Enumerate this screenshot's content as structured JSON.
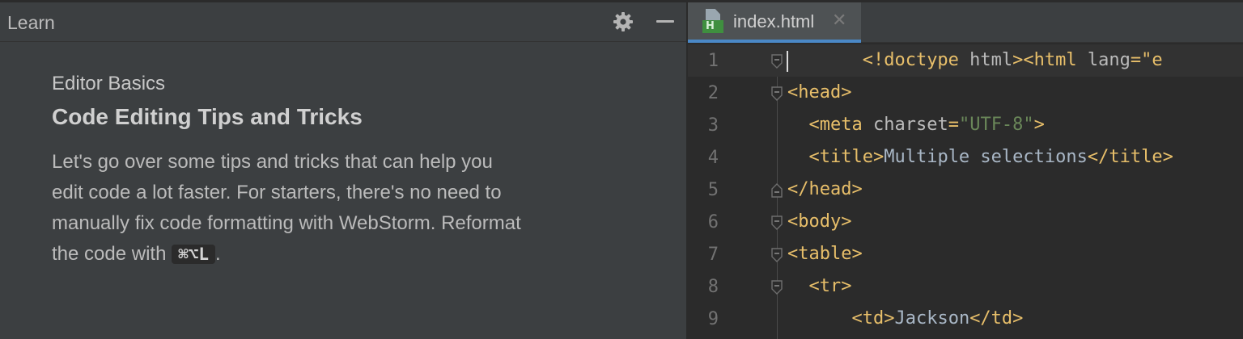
{
  "learn": {
    "title": "Learn",
    "section": "Editor Basics",
    "lesson_title": "Code Editing Tips and Tricks",
    "paragraph_lines": [
      "Let's go over some tips and tricks that can help you",
      "edit code a lot faster. For starters, there's no need to",
      "manually fix code formatting with WebStorm. Reformat",
      "the code with "
    ],
    "shortcut": "⌘⌥L",
    "paragraph_end": "."
  },
  "editor": {
    "tab": {
      "label": "index.html",
      "icon_badge": "H",
      "close": "✕"
    },
    "line_numbers": [
      "1",
      "2",
      "3",
      "4",
      "5",
      "6",
      "7",
      "8",
      "9"
    ],
    "lines": [
      {
        "indent": "       ",
        "parts": [
          [
            "tag",
            "<!doctype "
          ],
          [
            "attr",
            "html"
          ],
          [
            "tag",
            "><html "
          ],
          [
            "attr",
            "lang"
          ],
          [
            "tag",
            "=\"e"
          ]
        ]
      },
      {
        "indent": "",
        "parts": [
          [
            "tag",
            "<head>"
          ]
        ]
      },
      {
        "indent": "  ",
        "parts": [
          [
            "tag",
            "<meta "
          ],
          [
            "attr",
            "charset"
          ],
          [
            "tag",
            "="
          ],
          [
            "str",
            "\"UTF-8\""
          ],
          [
            "tag",
            ">"
          ]
        ]
      },
      {
        "indent": "  ",
        "parts": [
          [
            "tag",
            "<title>"
          ],
          [
            "txt",
            "Multiple selections"
          ],
          [
            "tag",
            "</title>"
          ]
        ]
      },
      {
        "indent": "",
        "parts": [
          [
            "tag",
            "</head>"
          ]
        ]
      },
      {
        "indent": "",
        "parts": [
          [
            "tag",
            "<body>"
          ]
        ]
      },
      {
        "indent": "",
        "parts": [
          [
            "tag",
            "<table>"
          ]
        ]
      },
      {
        "indent": "  ",
        "parts": [
          [
            "tag",
            "<tr>"
          ]
        ]
      },
      {
        "indent": "      ",
        "parts": [
          [
            "tag",
            "<td>"
          ],
          [
            "txt",
            "Jackson"
          ],
          [
            "tag",
            "</td>"
          ]
        ]
      }
    ]
  },
  "icons": {
    "settings": "gear-icon",
    "minimize": "minimize-icon",
    "file": "html-file-icon",
    "fold": "fold-marker-icon"
  },
  "colors": {
    "panel_bg": "#3c3f41",
    "editor_bg": "#2b2b2b",
    "tag": "#e8bf6a",
    "string": "#6a8759",
    "tab_underline": "#4a88c7"
  }
}
